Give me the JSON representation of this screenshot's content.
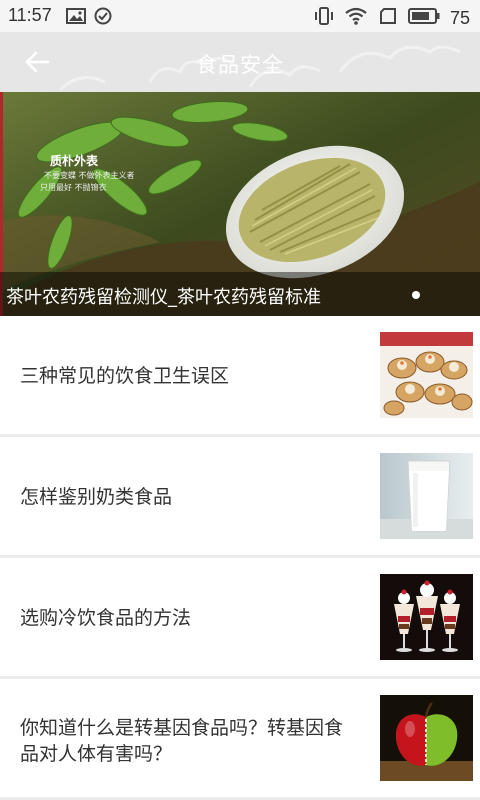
{
  "status_bar": {
    "time": "11:57",
    "battery_percent": "75"
  },
  "app_bar": {
    "title": "食品安全",
    "back_icon": "arrow-left-icon"
  },
  "banner": {
    "caption": "茶叶农药残留检测仪_茶叶农药残留标准",
    "brand_text": "质朴外表",
    "brand_sub_1": "不要变蝶  不做外表主义者",
    "brand_sub_2": "只用最好  不抛锦衣"
  },
  "news_items": [
    {
      "title": "三种常见的饮食卫生误区",
      "thumbnail": "dim-sum-image"
    },
    {
      "title": "怎样鉴别奶类食品",
      "thumbnail": "milk-glass-image"
    },
    {
      "title": "选购冷饮食品的方法",
      "thumbnail": "ice-cream-sundae-image"
    },
    {
      "title": "你知道什么是转基因食品吗？转基因食品对人体有害吗？",
      "thumbnail": "apple-image"
    }
  ]
}
